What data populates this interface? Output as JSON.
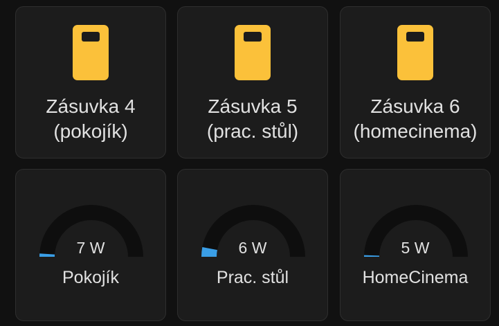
{
  "colors": {
    "background": "#111111",
    "card": "#1c1c1c",
    "icon": "#fbc13a",
    "gauge_track": "#0e0e0e",
    "gauge_fill": "#3a9ee6",
    "text": "#e1e1e1"
  },
  "buttons": [
    {
      "name": "Zásuvka 4\n(pokojík)",
      "icon": "power-socket-icon"
    },
    {
      "name": "Zásuvka 5\n(prac. stůl)",
      "icon": "power-socket-icon"
    },
    {
      "name": "Zásuvka 6\n(homecinema)",
      "icon": "power-socket-icon"
    }
  ],
  "gauges": [
    {
      "value": "7 W",
      "name": "Pokojík",
      "level": 0.02
    },
    {
      "value": "6 W",
      "name": "Prac. stůl",
      "level": 0.06
    },
    {
      "value": "5 W",
      "name": "HomeCinema",
      "level": 0.01
    }
  ]
}
